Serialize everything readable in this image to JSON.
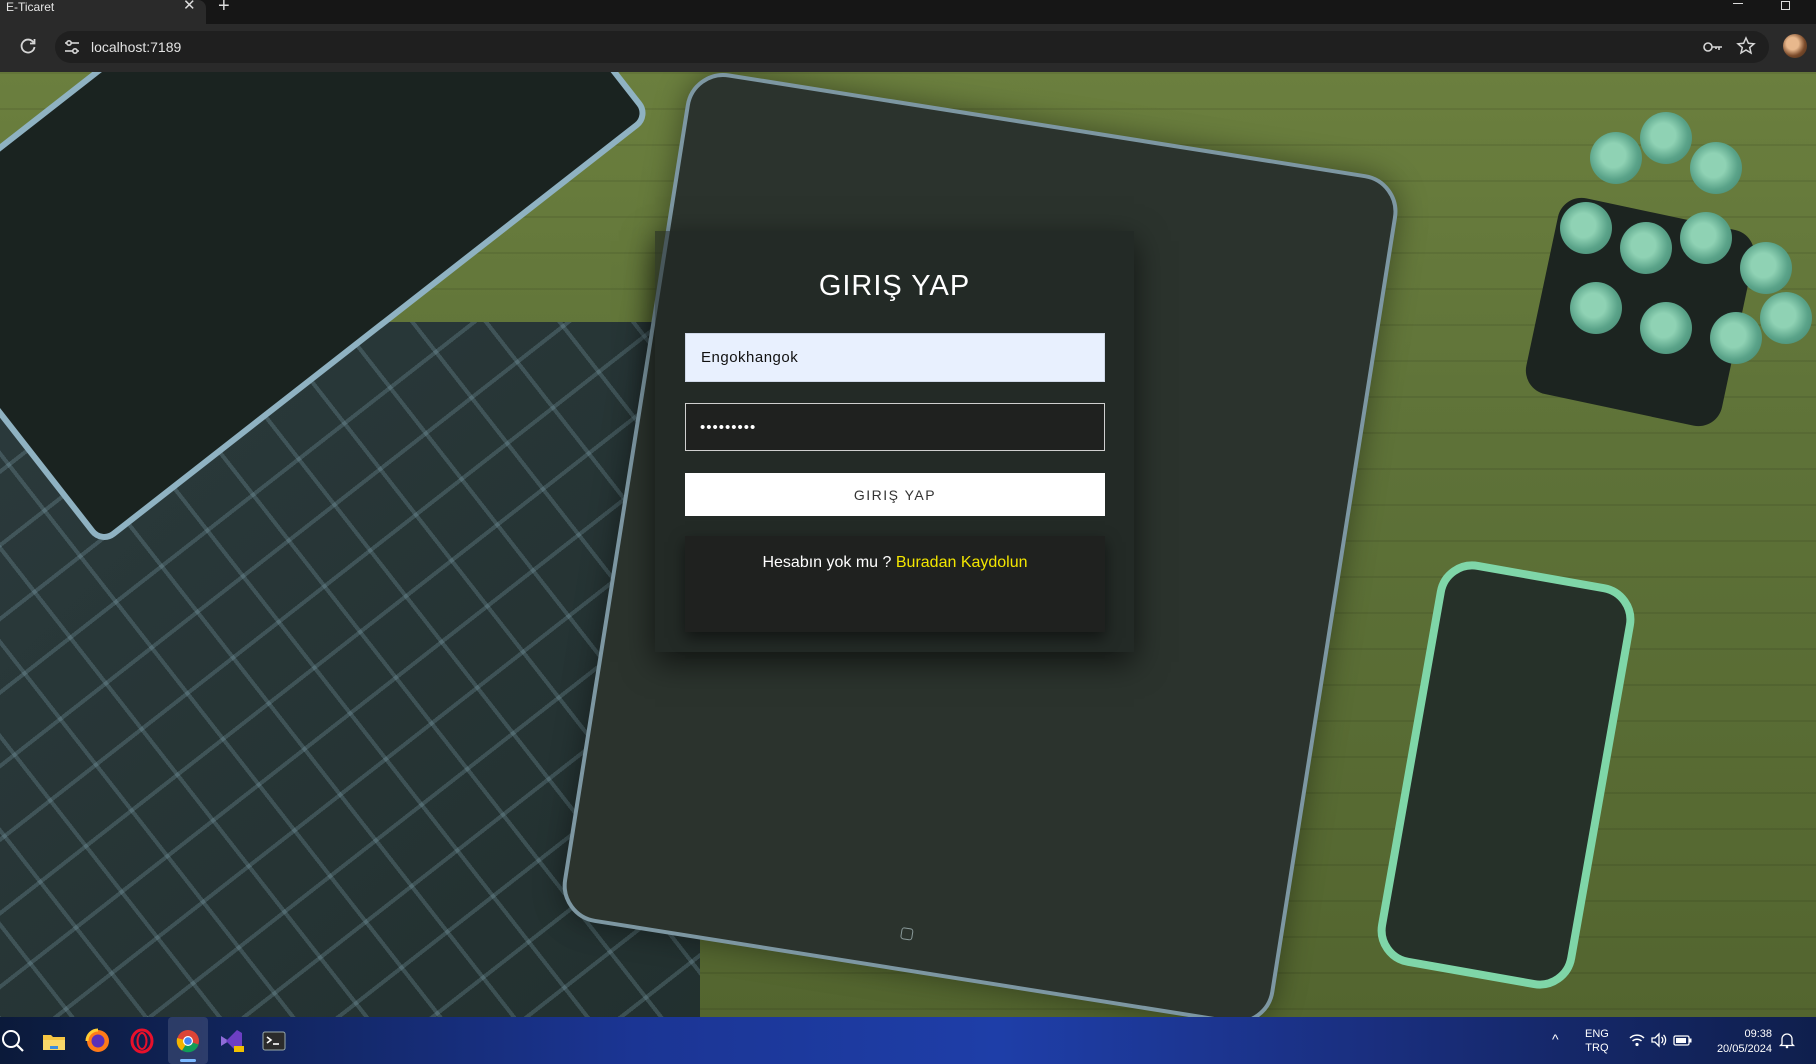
{
  "browser": {
    "tab_title": "E-Ticaret",
    "tab_close": "✕",
    "new_tab": "+",
    "url": "localhost:7189"
  },
  "login": {
    "title": "GIRIŞ YAP",
    "username_value": "Engokhangok",
    "password_value": "•••••••••",
    "submit_label": "GIRIŞ YAP",
    "register_prompt": "Hesabın yok mu ? ",
    "register_link": "Buradan Kaydolun"
  },
  "taskbar": {
    "apps": [
      "search-icon",
      "file-explorer-icon",
      "firefox-icon",
      "opera-icon",
      "chrome-icon",
      "visual-studio-icon",
      "terminal-icon"
    ],
    "tray_chevron": "^",
    "lang_line1": "ENG",
    "lang_line2": "TRQ",
    "time": "09:38",
    "date": "20/05/2024"
  },
  "colors": {
    "link": "#f3e600",
    "accent_taskbar": "#1e3ea8"
  }
}
